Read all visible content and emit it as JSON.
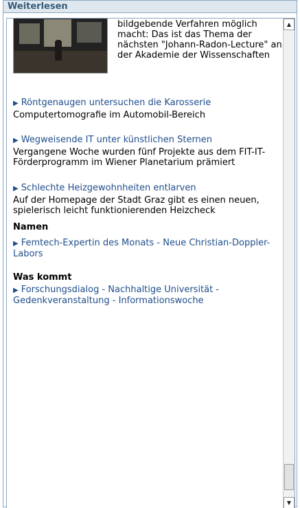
{
  "panel": {
    "title": "Weiterlesen"
  },
  "lead": {
    "text": "mit großer Rechenkapazität bildgebende Verfahren möglich macht: Das ist das Thema der nächsten \"Johann-Radon-Lecture\" an der Akademie der Wissenschaften"
  },
  "articles": [
    {
      "link": "Röntgenaugen untersuchen die Karosserie",
      "desc": "Computertomografie im Automobil-Bereich"
    },
    {
      "link": "Wegweisende IT unter künstlichen Sternen",
      "desc": "Vergangene Woche wurden fünf Projekte aus dem FIT-IT-Förderprogramm im Wiener Planetarium prämiert"
    },
    {
      "link": "Schlechte Heizgewohnheiten entlarven",
      "desc": "Auf der Homepage der Stadt Graz gibt es einen neuen, spielerisch leicht funktionierenden Heizcheck"
    }
  ],
  "sections": [
    {
      "title": "Namen",
      "link": "Femtech-Expertin des Monats - Neue Christian-Doppler-Labors"
    },
    {
      "title": "Was kommt",
      "link": "Forschungsdialog - Nachhaltige Universität - Gedenkveranstaltung - Informationswoche"
    }
  ],
  "icons": {
    "arrow": "triangle-right-icon",
    "scroll_up": "arrow-up-icon",
    "scroll_down": "arrow-down-icon"
  },
  "colors": {
    "link": "#1f4e8c",
    "header_bg": "#dfe8ef",
    "border": "#8aa7c1",
    "header_text": "#355c7a"
  }
}
